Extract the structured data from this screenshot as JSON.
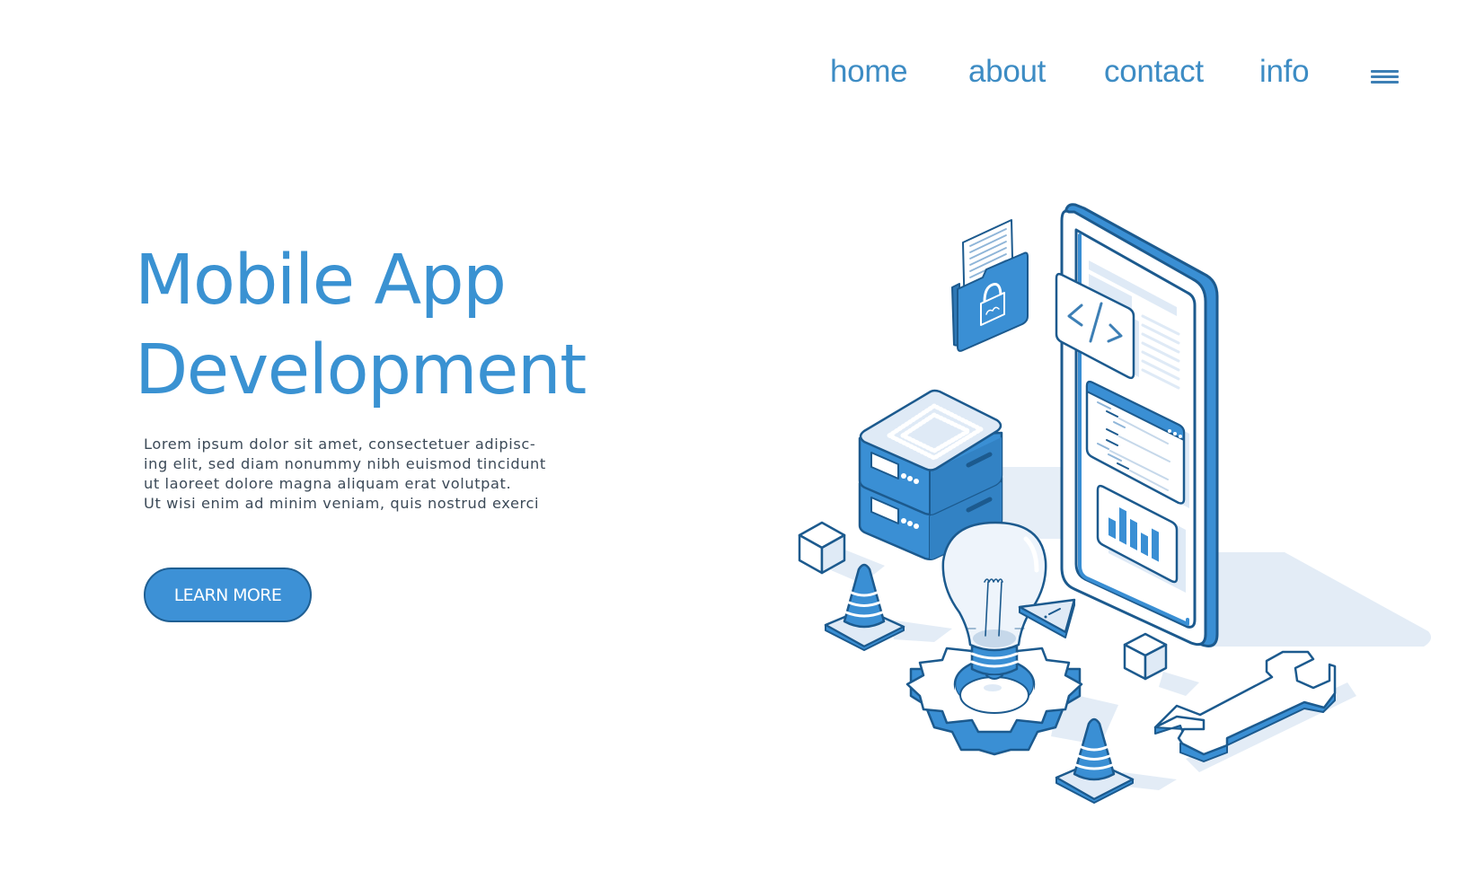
{
  "nav": {
    "items": [
      {
        "label": "home"
      },
      {
        "label": "about"
      },
      {
        "label": "contact"
      },
      {
        "label": "info"
      }
    ],
    "menu_icon": "hamburger-menu-icon"
  },
  "hero": {
    "title_lines": [
      "Mobile App",
      "Development"
    ],
    "paragraph_lines": [
      "Lorem ipsum dolor sit amet, consectetuer adipisc-",
      "ing elit, sed diam nonummy nibh euismod tincidunt",
      "ut laoreet dolore magna aliquam erat volutpat.",
      "Ut wisi enim ad minim veniam, quis nostrud exerci"
    ],
    "cta_label": "LEARN MORE"
  },
  "illustration": {
    "code_tag_label": "</>",
    "chart_bar_levels": [
      0.45,
      0.85,
      0.7,
      0.5,
      0.75
    ],
    "colors": {
      "primary": "#3a8fd4",
      "outline": "#1c5a8e",
      "light": "#dfeaf6",
      "shadow": "#e3ecf6",
      "white": "#ffffff"
    }
  }
}
